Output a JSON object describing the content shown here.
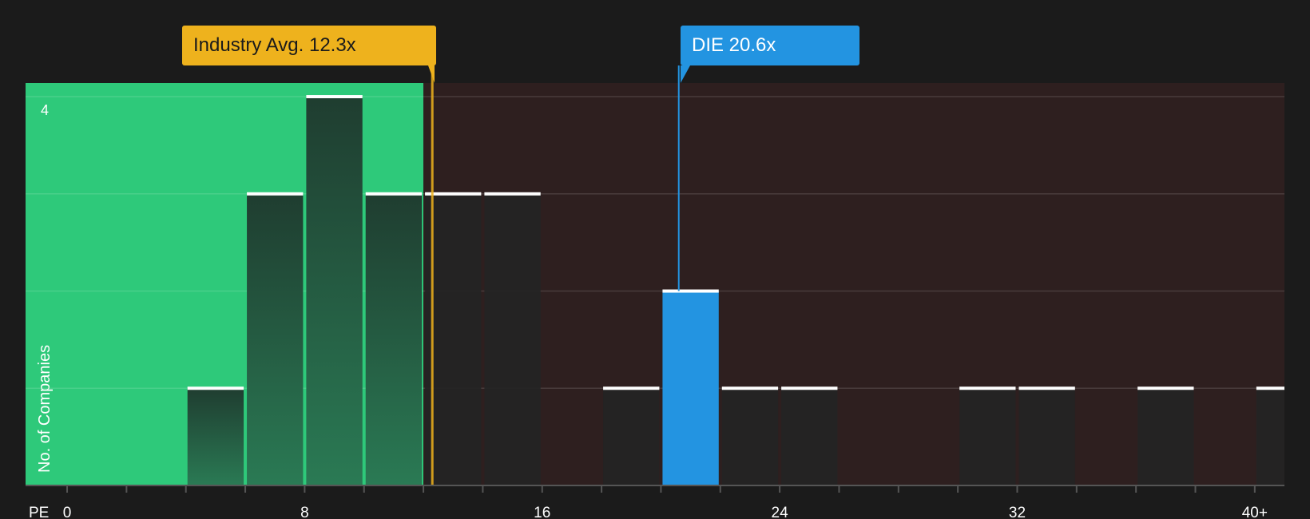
{
  "chart_data": {
    "type": "bar",
    "xlabel": "PE",
    "ylabel": "No. of Companies",
    "x_tick_labels": [
      "0",
      "8",
      "16",
      "24",
      "32",
      "40+"
    ],
    "x_ticks": [
      0,
      8,
      16,
      24,
      32,
      40
    ],
    "y_tick_labels": [
      "4"
    ],
    "xlim": [
      -1.4,
      41
    ],
    "ylim": [
      0,
      4.14
    ],
    "bin_width": 2,
    "bins": [
      {
        "x0": 4,
        "x1": 6,
        "count": 1
      },
      {
        "x0": 6,
        "x1": 8,
        "count": 3
      },
      {
        "x0": 8,
        "x1": 10,
        "count": 4
      },
      {
        "x0": 10,
        "x1": 12,
        "count": 3
      },
      {
        "x0": 12,
        "x1": 14,
        "count": 3
      },
      {
        "x0": 14,
        "x1": 16,
        "count": 3
      },
      {
        "x0": 18,
        "x1": 20,
        "count": 1
      },
      {
        "x0": 20,
        "x1": 22,
        "count": 2,
        "highlight": true
      },
      {
        "x0": 22,
        "x1": 24,
        "count": 1
      },
      {
        "x0": 24,
        "x1": 26,
        "count": 1
      },
      {
        "x0": 30,
        "x1": 32,
        "count": 1
      },
      {
        "x0": 32,
        "x1": 34,
        "count": 1
      },
      {
        "x0": 36,
        "x1": 38,
        "count": 1
      },
      {
        "x0": 40,
        "x1": 42,
        "count": 1
      }
    ],
    "industry_avg": {
      "label": "Industry Avg. 12.3x",
      "value": 12.3
    },
    "company": {
      "label": "DIE 20.6x",
      "value": 20.6
    },
    "undervalued_region_end": 12,
    "grid": true,
    "colors": {
      "background": "#1b1b1b",
      "undervalued": "#2ec97a",
      "overvalued": "#2e1f1f",
      "bar_dark": "#242424",
      "bar_cap": "#ffffff",
      "company": "#2394e1",
      "industry": "#eeb21d",
      "text": "#ffffff"
    }
  }
}
